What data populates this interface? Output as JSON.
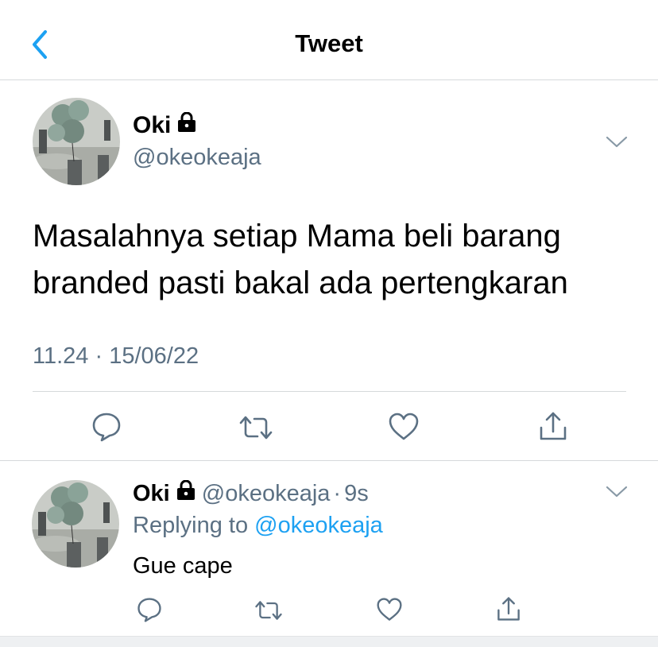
{
  "nav": {
    "title": "Tweet"
  },
  "tweet": {
    "author_name": "Oki",
    "author_handle": "@okeokeaja",
    "text": "Masalahnya setiap Mama beli barang branded pasti bakal ada pertengkaran",
    "timestamp": "11.24 · 15/06/22"
  },
  "reply": {
    "author_name": "Oki",
    "author_handle": "@okeokeaja",
    "separator": "·",
    "time": "9s",
    "replying_prefix": "Replying to",
    "replying_to": "@okeokeaja",
    "text": "Gue cape"
  },
  "icons": {
    "back": "chevron-left-icon",
    "lock": "lock-icon",
    "caret": "chevron-down-icon",
    "reply": "comment-icon",
    "retweet": "retweet-icon",
    "like": "heart-icon",
    "share": "share-icon"
  },
  "colors": {
    "accent": "#1da1f2",
    "secondary_text": "#5b7083",
    "icon_gray": "#5b7083",
    "divider": "#d6d9db"
  }
}
